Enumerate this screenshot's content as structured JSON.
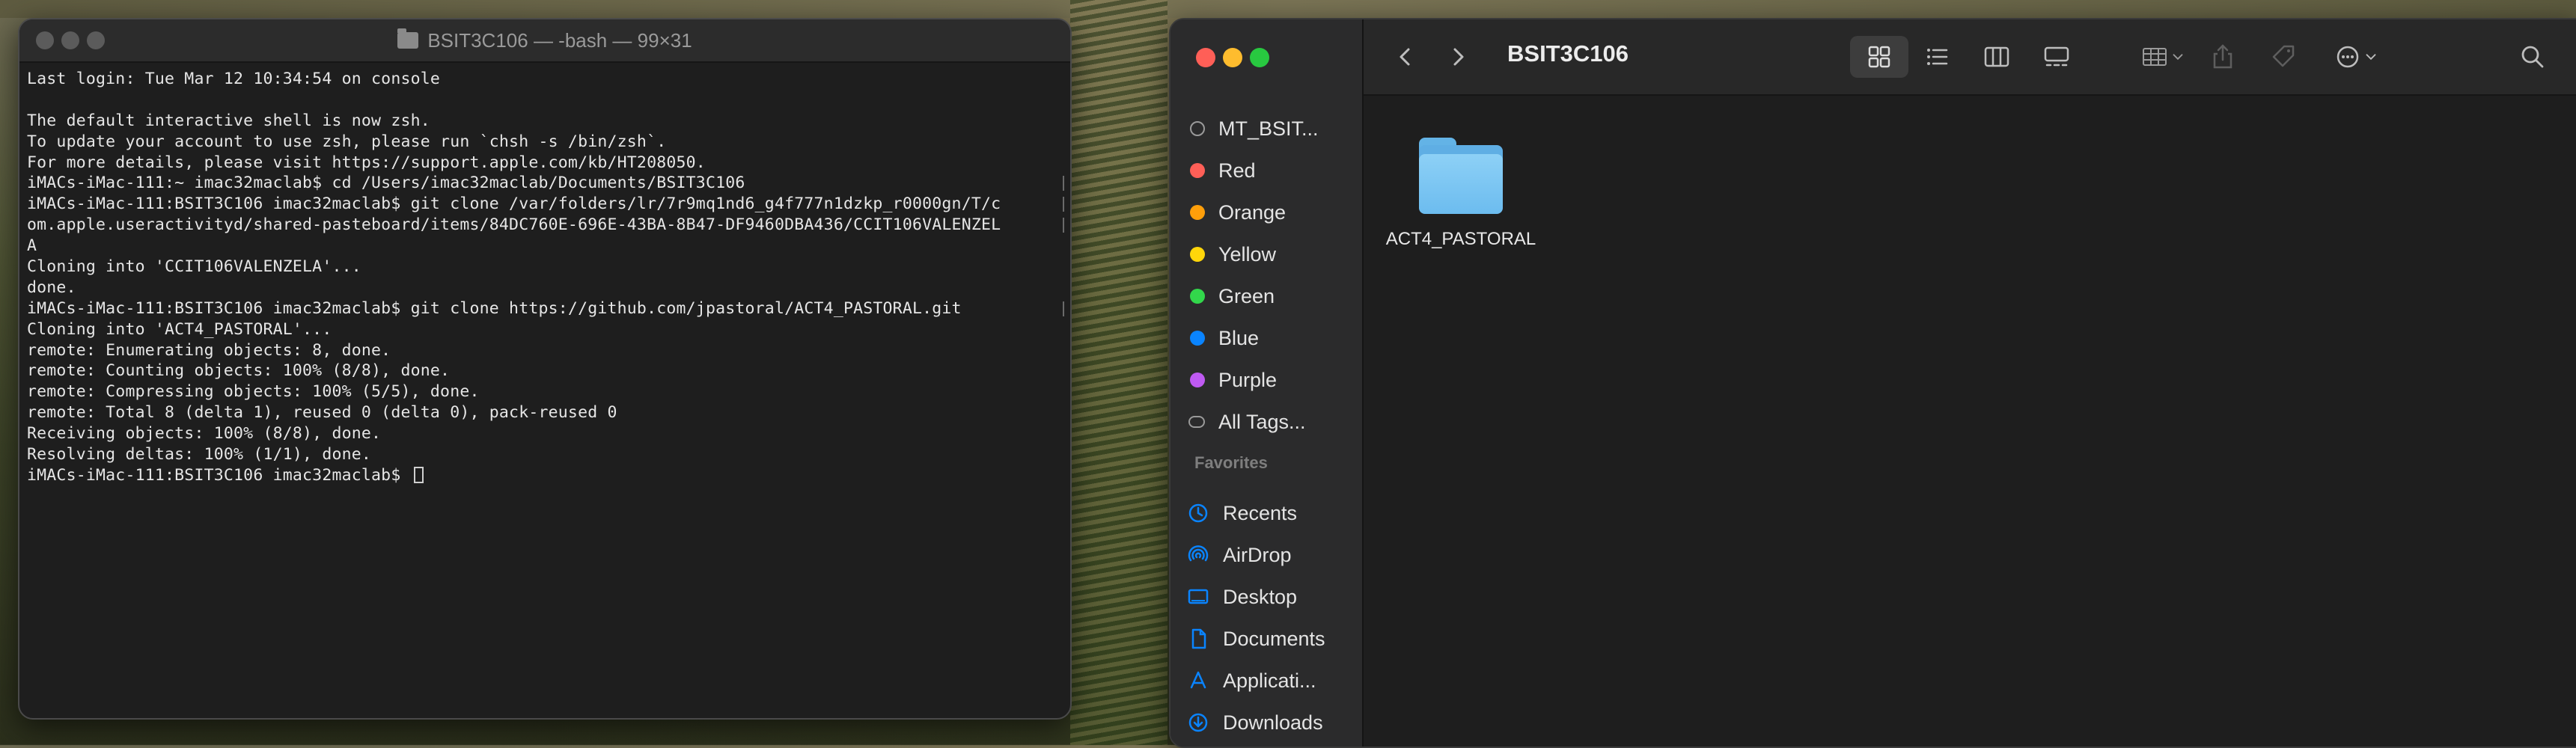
{
  "terminal": {
    "title": "BSIT3C106 — -bash — 99×31",
    "lines": [
      "Last login: Tue Mar 12 10:34:54 on console",
      "",
      "The default interactive shell is now zsh.",
      "To update your account to use zsh, please run `chsh -s /bin/zsh`.",
      "For more details, please visit https://support.apple.com/kb/HT208050.",
      "iMACs-iMac-111:~ imac32maclab$ cd /Users/imac32maclab/Documents/BSIT3C106",
      "iMACs-iMac-111:BSIT3C106 imac32maclab$ git clone /var/folders/lr/7r9mq1nd6_g4f777n1dzkp_r0000gn/T/c",
      "om.apple.useractivityd/shared-pasteboard/items/84DC760E-696E-43BA-8B47-DF9460DBA436/CCIT106VALENZEL",
      "A",
      "Cloning into 'CCIT106VALENZELA'...",
      "done.",
      "iMACs-iMac-111:BSIT3C106 imac32maclab$ git clone https://github.com/jpastoral/ACT4_PASTORAL.git",
      "Cloning into 'ACT4_PASTORAL'...",
      "remote: Enumerating objects: 8, done.",
      "remote: Counting objects: 100% (8/8), done.",
      "remote: Compressing objects: 100% (5/5), done.",
      "remote: Total 8 (delta 1), reused 0 (delta 0), pack-reused 0",
      "Receiving objects: 100% (8/8), done.",
      "Resolving deltas: 100% (1/1), done.",
      "iMACs-iMac-111:BSIT3C106 imac32maclab$ "
    ]
  },
  "finder": {
    "title": "BSIT3C106",
    "sidebar": {
      "tags": [
        {
          "label": "MT_BSIT...",
          "color": "ring"
        },
        {
          "label": "Red",
          "color": "#ff5f57"
        },
        {
          "label": "Orange",
          "color": "#ff9f0a"
        },
        {
          "label": "Yellow",
          "color": "#ffd60a"
        },
        {
          "label": "Green",
          "color": "#32d74b"
        },
        {
          "label": "Blue",
          "color": "#0a84ff"
        },
        {
          "label": "Purple",
          "color": "#bf5af2"
        },
        {
          "label": "All Tags...",
          "color": "tags"
        }
      ],
      "favorites_header": "Favorites",
      "favorites": [
        {
          "label": "Recents",
          "icon": "clock-icon"
        },
        {
          "label": "AirDrop",
          "icon": "airdrop-icon"
        },
        {
          "label": "Desktop",
          "icon": "desktop-icon"
        },
        {
          "label": "Documents",
          "icon": "document-icon"
        },
        {
          "label": "Applicati...",
          "icon": "applications-icon"
        },
        {
          "label": "Downloads",
          "icon": "download-icon"
        }
      ]
    },
    "items": [
      {
        "name": "ACT4_PASTORAL",
        "kind": "folder"
      }
    ],
    "colors": {
      "accent": "#0a84ff",
      "close": "#ff5f57",
      "minimize": "#febc2e",
      "zoom": "#28c840",
      "folder": "#6cbcef"
    }
  }
}
